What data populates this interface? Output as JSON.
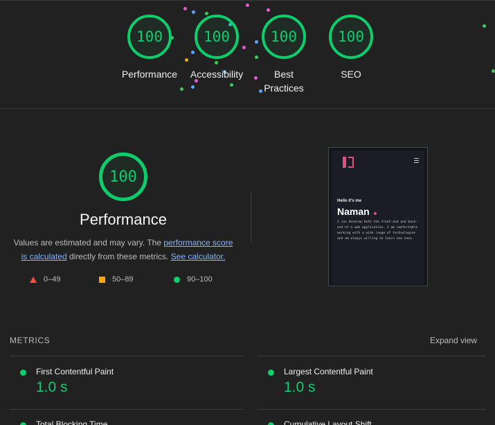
{
  "categories": [
    {
      "score": "100",
      "label": "Performance"
    },
    {
      "score": "100",
      "label": "Accessibility"
    },
    {
      "score": "100",
      "label": "Best Practices"
    },
    {
      "score": "100",
      "label": "SEO"
    }
  ],
  "performance": {
    "score": "100",
    "title": "Performance",
    "desc_prefix": "Values are estimated and may vary. The ",
    "link_score": "performance score is calculated",
    "desc_mid": " directly from these metrics. ",
    "link_calc": "See calculator."
  },
  "legend": [
    {
      "range": "0–49",
      "color": "#ff4e42"
    },
    {
      "range": "50–89",
      "color": "#ffa400"
    },
    {
      "range": "90–100",
      "color": "#0cce6b"
    }
  ],
  "screenshot": {
    "greeting": "Hello it's me",
    "name": "Naman",
    "bio": "I can develop both the front-and and back-end of a web application. I am comfortable working with a wide range of technologies and am always willing to learn new ones."
  },
  "metrics": {
    "title": "METRICS",
    "expand_label": "Expand view",
    "items": [
      {
        "label": "First Contentful Paint",
        "value": "1.0 s"
      },
      {
        "label": "Largest Contentful Paint",
        "value": "1.0 s"
      },
      {
        "label": "Total Blocking Time",
        "value": ""
      },
      {
        "label": "Cumulative Layout Shift",
        "value": ""
      }
    ]
  },
  "colors": {
    "pass": "#0cce6b",
    "average": "#ffa400",
    "fail": "#ff4e42",
    "background": "#212121"
  }
}
